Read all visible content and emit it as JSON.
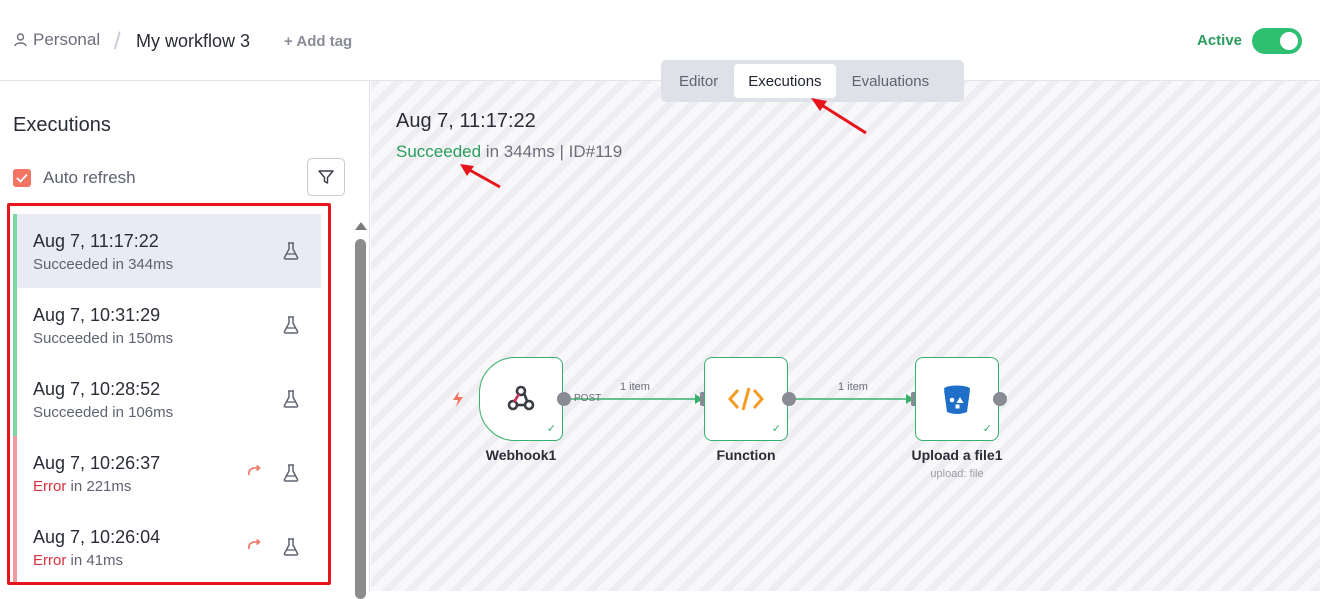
{
  "header": {
    "breadcrumb_personal": "Personal",
    "breadcrumb_separator": "/",
    "workflow_title": "My workflow 3",
    "add_tag": "+ Add tag",
    "active_label": "Active",
    "active_on": true
  },
  "tabs": [
    {
      "label": "Editor",
      "active": false
    },
    {
      "label": "Executions",
      "active": true
    },
    {
      "label": "Evaluations",
      "active": false
    }
  ],
  "sidebar": {
    "title": "Executions",
    "auto_refresh_label": "Auto refresh",
    "auto_refresh_checked": true,
    "filter_icon": "filter-icon",
    "executions": [
      {
        "time": "Aug 7, 11:17:22",
        "status_word": "Succeeded",
        "status_rest": " in 344ms",
        "state": "success",
        "selected": true,
        "retry": false
      },
      {
        "time": "Aug 7, 10:31:29",
        "status_word": "Succeeded",
        "status_rest": " in 150ms",
        "state": "success",
        "selected": false,
        "retry": false
      },
      {
        "time": "Aug 7, 10:28:52",
        "status_word": "Succeeded",
        "status_rest": " in 106ms",
        "state": "success",
        "selected": false,
        "retry": false
      },
      {
        "time": "Aug 7, 10:26:37",
        "status_word": "Error",
        "status_rest": " in 221ms",
        "state": "error",
        "selected": false,
        "retry": true
      },
      {
        "time": "Aug 7, 10:26:04",
        "status_word": "Error",
        "status_rest": " in 41ms",
        "state": "error",
        "selected": false,
        "retry": true
      }
    ]
  },
  "canvas": {
    "execution_date": "Aug 7, 11:17:22",
    "summary_status": "Succeeded",
    "summary_duration": " in 344ms",
    "summary_separator": " | ",
    "summary_id": "ID#119",
    "nodes": [
      {
        "name": "Webhook1",
        "icon": "webhook-icon",
        "subtitle": ""
      },
      {
        "name": "Function",
        "icon": "code-icon",
        "subtitle": ""
      },
      {
        "name": "Upload a file1",
        "icon": "bucket-icon",
        "subtitle": "upload: file"
      }
    ],
    "connections": [
      {
        "label": "1 item",
        "method": "POST"
      },
      {
        "label": "1 item",
        "method": ""
      }
    ]
  },
  "colors": {
    "success": "#2a9d5c",
    "error": "#d9303e",
    "accent": "#f07563",
    "annotation": "#e8141c"
  }
}
